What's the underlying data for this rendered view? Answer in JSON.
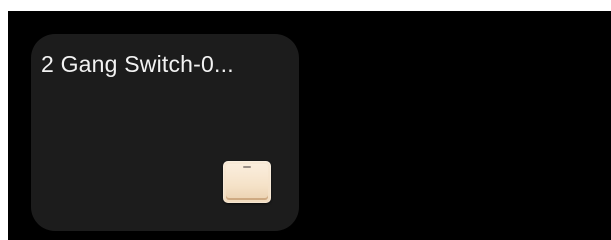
{
  "device_card": {
    "name": "2 Gang Switch-0...",
    "icon": "wall-switch-icon",
    "icon_color": "#f5e2c8",
    "card_color": "#1c1c1c"
  }
}
